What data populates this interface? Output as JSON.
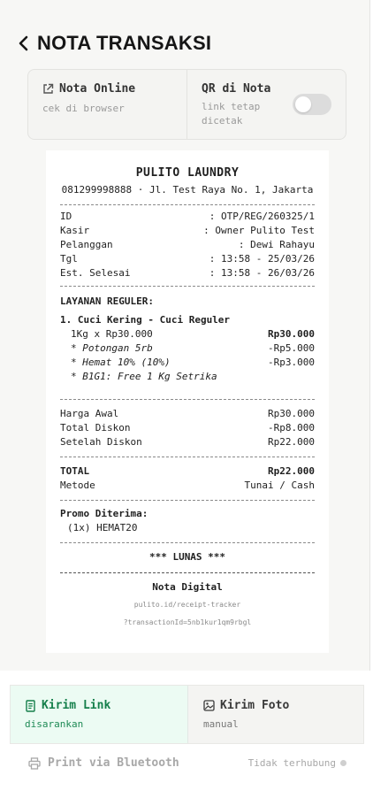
{
  "header": {
    "title": "NOTA TRANSAKSI"
  },
  "options": {
    "online": {
      "title": "Nota Online",
      "subtitle": "cek di browser"
    },
    "qr": {
      "title": "QR di Nota",
      "subtitle": "link tetap dicetak",
      "enabled": false
    }
  },
  "receipt": {
    "store_name": "PULITO LAUNDRY",
    "store_address": "081299998888 · Jl. Test Raya No. 1, Jakarta",
    "info": [
      {
        "label": "ID",
        "value": ": OTP/REG/260325/1"
      },
      {
        "label": "Kasir",
        "value": ": Owner Pulito Test"
      },
      {
        "label": "Pelanggan",
        "value": ": Dewi Rahayu"
      },
      {
        "label": "Tgl",
        "value": ": 13:58 - 25/03/26"
      },
      {
        "label": "Est. Selesai",
        "value": ": 13:58 - 26/03/26"
      }
    ],
    "section_title": "LAYANAN REGULER:",
    "item": {
      "name": "1. Cuci Kering - Cuci Reguler",
      "qty_line": "1Kg x Rp30.000",
      "qty_amount": "Rp30.000",
      "discounts": [
        {
          "label": "* Potongan 5rb",
          "amount": "-Rp5.000"
        },
        {
          "label": "* Hemat 10% (10%)",
          "amount": "-Rp3.000"
        },
        {
          "label": "* B1G1: Free 1 Kg Setrika",
          "amount": ""
        }
      ]
    },
    "summary": [
      {
        "label": "Harga Awal",
        "value": "Rp30.000"
      },
      {
        "label": "Total Diskon",
        "value": "-Rp8.000"
      },
      {
        "label": "Setelah Diskon",
        "value": "Rp22.000"
      }
    ],
    "total_label": "TOTAL",
    "total_value": "Rp22.000",
    "method_label": "Metode",
    "method_value": "Tunai / Cash",
    "promo_title": "Promo Diterima:",
    "promo_line": "(1x) HEMAT20",
    "status": "*** LUNAS ***",
    "digital_title": "Nota Digital",
    "digital_link_1": "pulito.id/receipt-tracker",
    "digital_link_2": "?transactionId=5nb1kur1qm9rbgl"
  },
  "send": {
    "link": {
      "title": "Kirim Link",
      "subtitle": "disarankan"
    },
    "photo": {
      "title": "Kirim Foto",
      "subtitle": "manual"
    }
  },
  "print": {
    "label": "Print via Bluetooth",
    "status": "Tidak terhubung"
  },
  "colors": {
    "accent_green": "#157f4b",
    "accent_green_bg": "#ecfbf3",
    "muted": "#a8a8a8"
  }
}
